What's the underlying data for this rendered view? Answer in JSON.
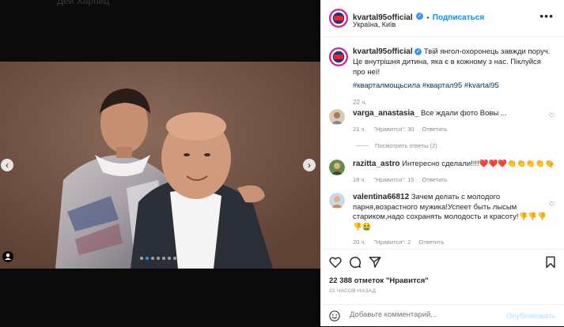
{
  "backdrop": {
    "text": "Дей Харпиц"
  },
  "post": {
    "username": "kvartal95official",
    "follow_label": "Подписаться",
    "separator": "•",
    "location": "Україна, Київ",
    "more_label": "•••",
    "caption": "Твій янгол-охоронець завжди поруч. Це внутрішня дитина, яка є в кожному з нас. Піклуйся про неї!",
    "hashtags": "#кварталмощьсила #квартал95 #kvartal95",
    "caption_time": "22 ч.",
    "likes": "22 388 отметок \"Нравится\"",
    "time_ago": "22 ЧАСОВ НАЗАД",
    "comment_placeholder": "Добавьте комментарий...",
    "publish_label": "Опубликовать",
    "media": {
      "slide_count": 7,
      "active_slide": 2
    }
  },
  "comments": [
    {
      "username": "varga_anastasia_",
      "text": "Все ждали фото Вовы ...",
      "time": "21 ч.",
      "likes": "\"Нравится\": 30",
      "reply": "Ответить",
      "view_replies": "Посмотреть ответы (2)"
    },
    {
      "username": "razitta_astro",
      "text": "Интересно сделали!!!!❤️❤️❤️👏👏👏👏👏",
      "time": "18 ч.",
      "likes": "\"Нравится\": 15",
      "reply": "Ответить"
    },
    {
      "username": "valentina66812",
      "text": "Зачем делать с молодого парня,возрастного мужика!Успеет быть лысым стариком,надо сохранять молодость и красоту!👎👎👎👎🤮",
      "time": "20 ч.",
      "likes": "\"Нравится\": 2",
      "reply": "Ответить"
    }
  ],
  "colors": {
    "accent": "#0095f6",
    "verified": "#3897f0",
    "hashtag": "#00376b",
    "muted": "#8e8e8e"
  }
}
